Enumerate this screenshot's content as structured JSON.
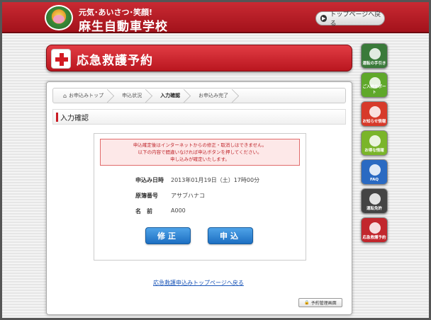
{
  "header": {
    "tagline": "元気･あいさつ･笑顔!",
    "school_name": "麻生自動車学校",
    "top_button_label": "トップページへ戻る",
    "logo_icon": "school-mascot-logo"
  },
  "banner": {
    "title": "応急救護予約",
    "icon": "red-cross-icon"
  },
  "breadcrumb": [
    {
      "label": "お申込みトップ",
      "icon": "home-icon"
    },
    {
      "label": "申込状況"
    },
    {
      "label": "入力確認",
      "active": true
    },
    {
      "label": "お申込み完了"
    }
  ],
  "section": {
    "heading": "入力確認"
  },
  "warning": {
    "line1": "申込確定後はインターネットからの修正・取消しはできません。",
    "line2": "以下の内容で間違いなければ申込ボタンを押してください。",
    "line3": "申し込みが確定いたします。"
  },
  "details": [
    {
      "label": "申込み日時",
      "value": "2013年01月19日（土）17時00分"
    },
    {
      "label": "原簿番号",
      "value": "アサブハナコ"
    },
    {
      "label": "名　前",
      "value": "A000"
    }
  ],
  "buttons": {
    "edit": "修正",
    "submit": "申込"
  },
  "back_link": "応急救護申込みトップページへ戻る",
  "mgmt_button": "予約管理画面",
  "sidebar": [
    {
      "label": "運転の手引き",
      "color": "#3a7a3a",
      "icon": "manual-icon"
    },
    {
      "label": "ご入校サポート",
      "color": "#5fa82a",
      "icon": "support-icon"
    },
    {
      "label": "お知らせ情報",
      "color": "#d73a2a",
      "icon": "info-icon"
    },
    {
      "label": "お得な情報",
      "color": "#7ab52a",
      "icon": "deal-icon"
    },
    {
      "label": "FAQ",
      "color": "#2a6ac2",
      "icon": "faq-icon"
    },
    {
      "label": "運転免許",
      "color": "#444444",
      "icon": "license-icon"
    },
    {
      "label": "応急救護予約",
      "color": "#c2272d",
      "icon": "first-aid-icon"
    }
  ]
}
